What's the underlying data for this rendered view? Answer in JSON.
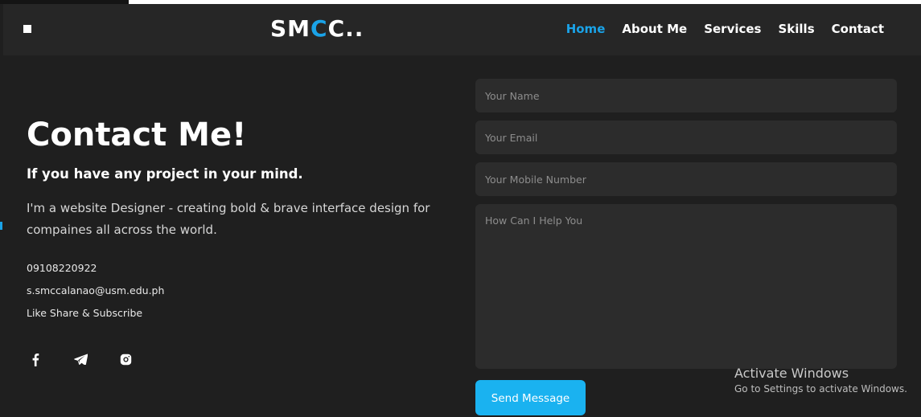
{
  "header": {
    "logo_prefix": "SM",
    "logo_accent": "C",
    "logo_suffix": "C..",
    "menu_icon": "square-menu-icon",
    "nav": [
      {
        "label": "Home",
        "active": true
      },
      {
        "label": "About Me",
        "active": false
      },
      {
        "label": "Services",
        "active": false
      },
      {
        "label": "Skills",
        "active": false
      },
      {
        "label": "Contact",
        "active": false
      }
    ]
  },
  "contact": {
    "title": "Contact Me!",
    "subtitle": "If you have any project in your mind.",
    "description": "I'm a website Designer - creating bold & brave interface design for compaines all across the world.",
    "phone": "09108220922",
    "email": "s.smccalanao@usm.edu.ph",
    "tagline": "Like Share & Subscribe",
    "socials": [
      "facebook-icon",
      "telegram-icon",
      "instagram-icon"
    ]
  },
  "form": {
    "name_placeholder": "Your Name",
    "email_placeholder": "Your Email",
    "mobile_placeholder": "Your Mobile Number",
    "message_placeholder": "How Can I Help You",
    "submit_label": "Send Message"
  },
  "watermark": {
    "title": "Activate Windows",
    "subtitle": "Go to Settings to activate Windows."
  },
  "colors": {
    "accent": "#1aa3e8",
    "background": "#1f1f1f",
    "navbar": "#262626",
    "field": "#2c2c2c",
    "button": "#1ab2f0"
  }
}
